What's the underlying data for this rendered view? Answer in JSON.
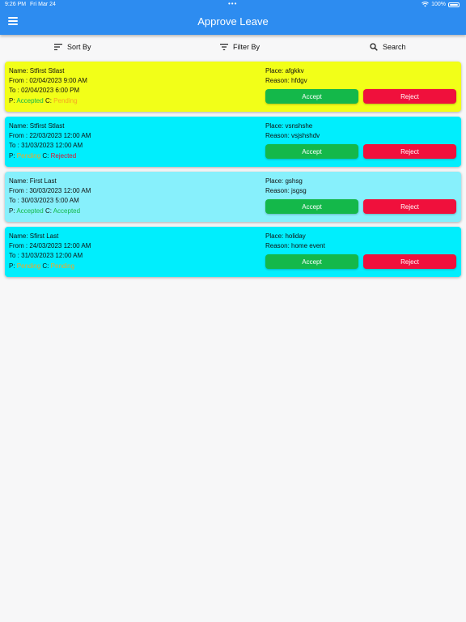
{
  "status_bar": {
    "time": "9:26 PM",
    "date": "Fri Mar 24",
    "dots": "•••",
    "battery": "100%"
  },
  "header": {
    "title": "Approve Leave"
  },
  "toolbar": {
    "sort_label": "Sort By",
    "filter_label": "Filter By",
    "search_label": "Search"
  },
  "colors": {
    "header": "#2d8cf0",
    "accepted": "#14b84a",
    "pending": "#f5a623",
    "rejected": "#e0102e",
    "accept_button": "#14b84a",
    "reject_button": "#f0103c"
  },
  "cards": [
    {
      "name": "Name: Stfirst Stlast",
      "from": "From : 02/04/2023  9:00 AM",
      "to": "To : 02/04/2023  6:00 PM",
      "p_label": "P:",
      "p_status": "Accepted",
      "c_label": "C:",
      "c_status": "Pending",
      "place": "Place: afgkkv",
      "reason": "Reason: hfdgv",
      "accept_label": "Accept",
      "reject_label": "Reject",
      "bg": "#f2ff18"
    },
    {
      "name": "Name: Stfirst Stlast",
      "from": "From : 22/03/2023  12:00 AM",
      "to": "To : 31/03/2023  12:00 AM",
      "p_label": "P:",
      "p_status": "Pending",
      "c_label": "C:",
      "c_status": "Rejected",
      "place": "Place: vsnshshe",
      "reason": "Reason: vsjshshdv",
      "accept_label": "Accept",
      "reject_label": "Reject",
      "bg": "#00eefd"
    },
    {
      "name": "Name: First Last",
      "from": "From : 30/03/2023  12:00 AM",
      "to": "To : 30/03/2023  5:00 AM",
      "p_label": "P:",
      "p_status": "Accepted",
      "c_label": "C:",
      "c_status": "Accepted",
      "place": "Place: gshsg",
      "reason": "Reason: jsgsg",
      "accept_label": "Accept",
      "reject_label": "Reject",
      "bg": "#87f0fc"
    },
    {
      "name": "Name: Sfirst Last",
      "from": "From : 24/03/2023  12:00 AM",
      "to": "To : 31/03/2023  12:00 AM",
      "p_label": "P:",
      "p_status": "Pending",
      "c_label": "C:",
      "c_status": "Pending",
      "place": "Place: holiday",
      "reason": "Reason: home event",
      "accept_label": "Accept",
      "reject_label": "Reject",
      "bg": "#00eefd"
    }
  ]
}
